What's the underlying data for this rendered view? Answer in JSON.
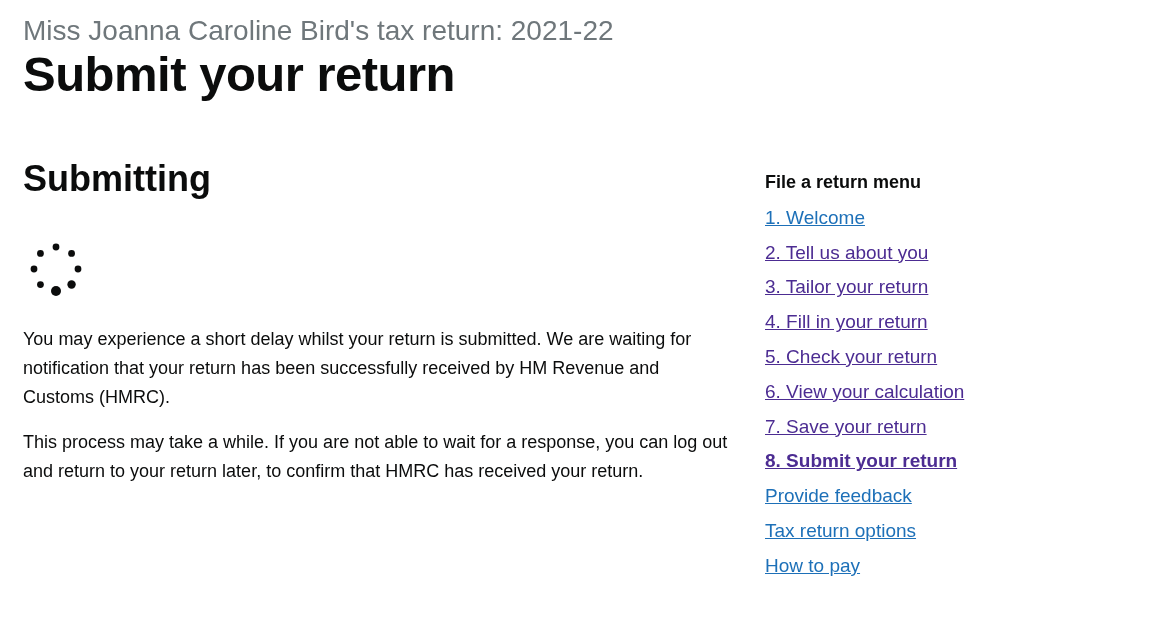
{
  "caption": "Miss Joanna Caroline Bird's tax return:  2021-22",
  "title": "Submit your return",
  "main": {
    "heading": "Submitting",
    "paragraphs": [
      "You may experience a short delay whilst your return is submitted. We are waiting for notification that your return has been successfully received by HM Revenue and Customs (HMRC).",
      "This process may take a while. If you are not able to wait for a response, you can log out and return to your return later, to confirm that HMRC has received your return."
    ]
  },
  "menu": {
    "heading": "File a return menu",
    "items": [
      {
        "label": "1. Welcome",
        "visited": false,
        "selected": false
      },
      {
        "label": "2. Tell us about you",
        "visited": true,
        "selected": false
      },
      {
        "label": "3. Tailor your return",
        "visited": true,
        "selected": false
      },
      {
        "label": "4. Fill in your return",
        "visited": true,
        "selected": false
      },
      {
        "label": "5. Check your return",
        "visited": true,
        "selected": false
      },
      {
        "label": "6. View your calculation",
        "visited": true,
        "selected": false
      },
      {
        "label": "7. Save your return",
        "visited": true,
        "selected": false
      },
      {
        "label": "8. Submit your return",
        "visited": true,
        "selected": true
      },
      {
        "label": "Provide feedback",
        "visited": false,
        "selected": false
      },
      {
        "label": "Tax return options",
        "visited": false,
        "selected": false
      },
      {
        "label": "How to pay",
        "visited": false,
        "selected": false
      }
    ]
  }
}
